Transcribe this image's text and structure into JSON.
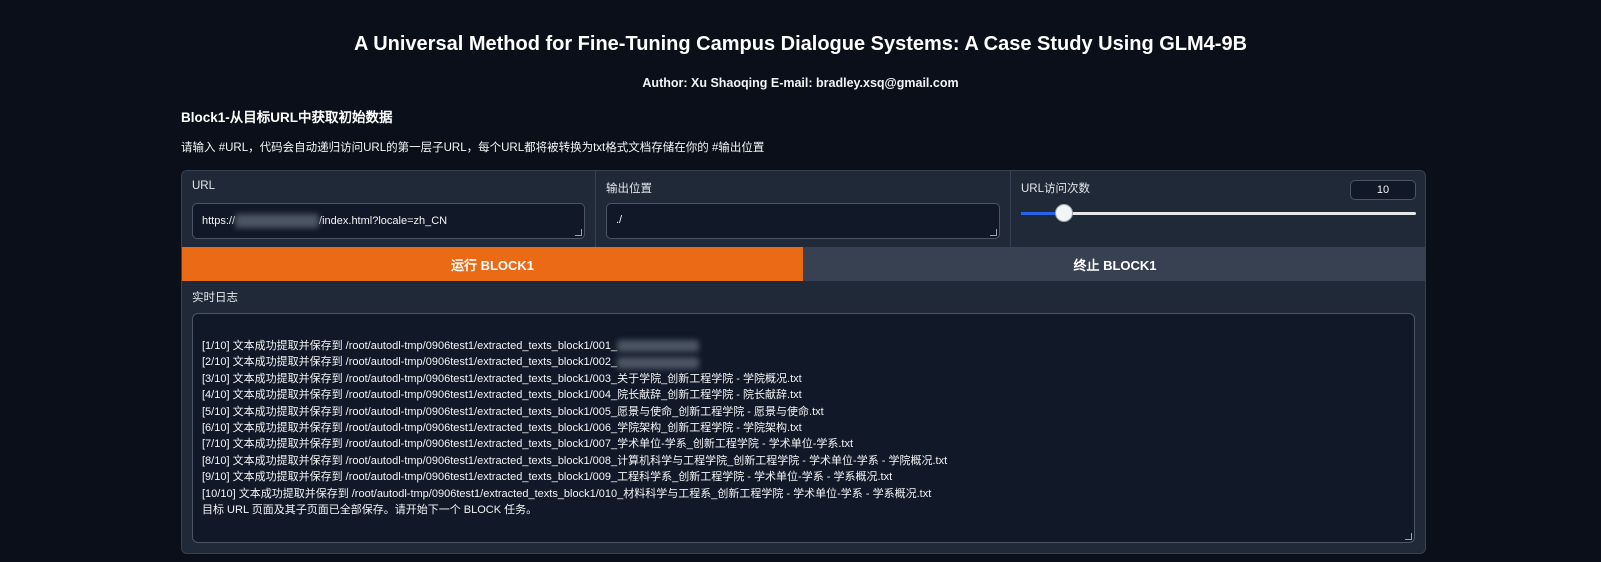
{
  "header": {
    "title": "A Universal Method for Fine-Tuning Campus Dialogue Systems: A Case Study Using GLM4-9B",
    "author": "Author: Xu Shaoqing E-mail: bradley.xsq@gmail.com"
  },
  "block1": {
    "heading": "Block1-从目标URL中获取初始数据",
    "description": "请输入 #URL，代码会自动递归访问URL的第一层子URL，每个URL都将被转换为txt格式文档存储在你的 #输出位置",
    "url_field": {
      "label": "URL",
      "value_prefix": "https://",
      "value_suffix": "/index.html?locale=zh_CN"
    },
    "output_field": {
      "label": "输出位置",
      "value": "./"
    },
    "visit_count": {
      "label": "URL访问次数",
      "value": "10",
      "slider_fraction": 0.11
    },
    "run_button": "运行 BLOCK1",
    "stop_button": "终止 BLOCK1",
    "log_label": "实时日志",
    "log_lines": [
      "[1/10] 文本成功提取并保存到 /root/autodl-tmp/0906test1/extracted_texts_block1/001_",
      "[2/10] 文本成功提取并保存到 /root/autodl-tmp/0906test1/extracted_texts_block1/002_",
      "[3/10] 文本成功提取并保存到 /root/autodl-tmp/0906test1/extracted_texts_block1/003_关于学院_创新工程学院 - 学院概况.txt",
      "[4/10] 文本成功提取并保存到 /root/autodl-tmp/0906test1/extracted_texts_block1/004_院长献辞_创新工程学院 - 院长献辞.txt",
      "[5/10] 文本成功提取并保存到 /root/autodl-tmp/0906test1/extracted_texts_block1/005_愿景与使命_创新工程学院 - 愿景与使命.txt",
      "[6/10] 文本成功提取并保存到 /root/autodl-tmp/0906test1/extracted_texts_block1/006_学院架构_创新工程学院 - 学院架构.txt",
      "[7/10] 文本成功提取并保存到 /root/autodl-tmp/0906test1/extracted_texts_block1/007_学术单位-学系_创新工程学院 - 学术单位-学系.txt",
      "[8/10] 文本成功提取并保存到 /root/autodl-tmp/0906test1/extracted_texts_block1/008_计算机科学与工程学院_创新工程学院 - 学术单位-学系 - 学院概况.txt",
      "[9/10] 文本成功提取并保存到 /root/autodl-tmp/0906test1/extracted_texts_block1/009_工程科学系_创新工程学院 - 学术单位-学系 - 学系概况.txt",
      "[10/10] 文本成功提取并保存到 /root/autodl-tmp/0906test1/extracted_texts_block1/010_材料科学与工程系_创新工程学院 - 学术单位-学系 - 学系概况.txt",
      "目标 URL 页面及其子页面已全部保存。请开始下一个 BLOCK 任务。"
    ]
  },
  "colors": {
    "background": "#0b0f19",
    "panel": "#1f2937",
    "run_accent": "#ea6a16",
    "slider_accent": "#2563eb"
  }
}
